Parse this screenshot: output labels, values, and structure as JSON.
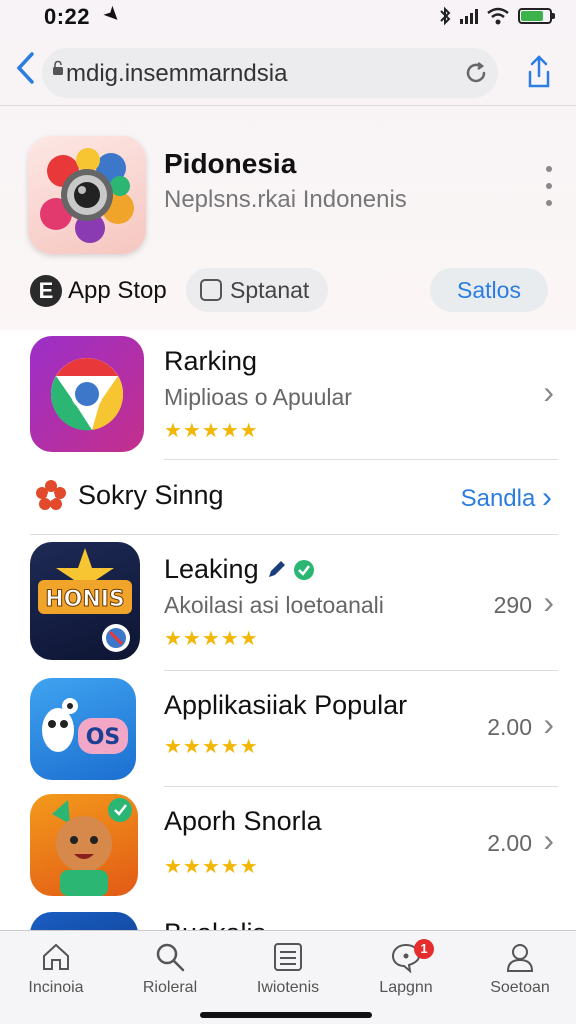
{
  "status_bar": {
    "time": "0:22"
  },
  "browser": {
    "url": "mdig.insemmarndsia"
  },
  "app": {
    "title": "Pidonesia",
    "subtitle": "Neplsns.rkai Indonenis",
    "chips": {
      "store": "App Stop",
      "store_logo": "E",
      "toggle": "Sptanat",
      "action": "Satlos"
    }
  },
  "rows": [
    {
      "title": "Rarking",
      "subtitle": "Miplioas o Apuular",
      "stars": "★★★★★"
    }
  ],
  "section": {
    "title": "Sokry Sinng",
    "link": "Sandla"
  },
  "ranked": [
    {
      "title": "Leaking",
      "subtitle": "Akoilasi asi loetoanali",
      "stars": "★★★★★",
      "value": "290",
      "icon_text": "HONIS"
    },
    {
      "title": "Applikasiiak Popular",
      "stars": "★★★★★",
      "value": "2.00",
      "icon_text": "OS"
    },
    {
      "title": "Aporh Snorla",
      "stars": "★★★★★",
      "value": "2.00"
    },
    {
      "title": "Buakalis"
    }
  ],
  "tabs": [
    {
      "label": "Incinoia",
      "icon": "home-icon"
    },
    {
      "label": "Rioleral",
      "icon": "search-icon"
    },
    {
      "label": "Iwiotenis",
      "icon": "list-icon"
    },
    {
      "label": "Lapgnn",
      "icon": "chat-icon",
      "badge": "1"
    },
    {
      "label": "Soetoan",
      "icon": "person-icon"
    }
  ],
  "colors": {
    "accent": "#2b7de1",
    "star": "#f2b705",
    "badge": "#e52d2d"
  }
}
